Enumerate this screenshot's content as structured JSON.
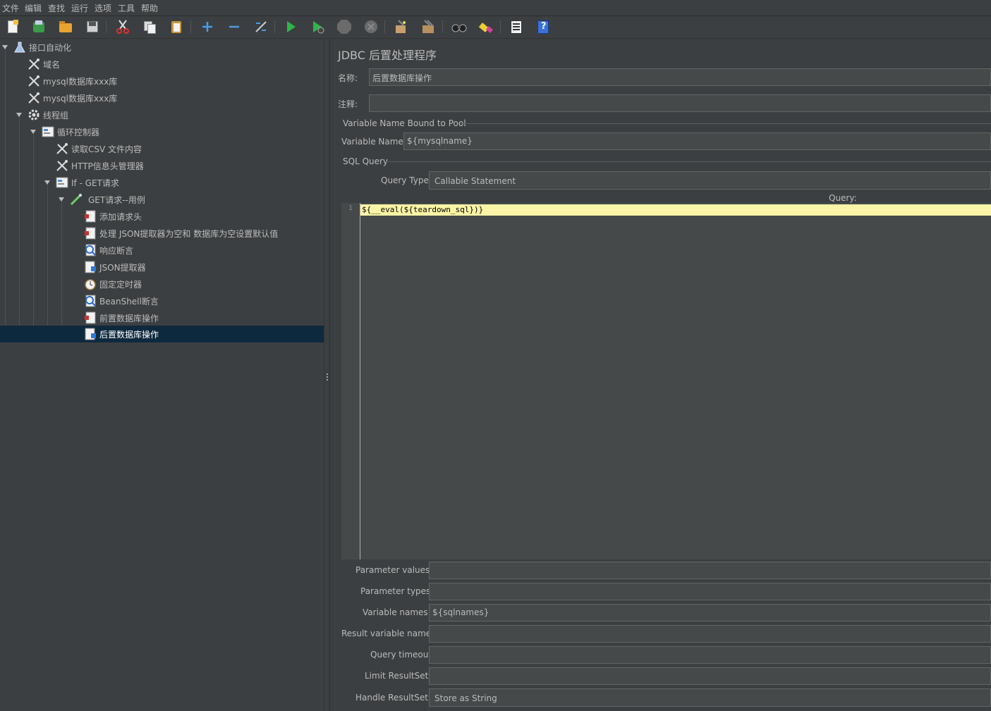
{
  "menu": [
    "文件",
    "编辑",
    "查找",
    "运行",
    "选项",
    "工具",
    "帮助"
  ],
  "toolbar_icons": [
    "new-icon",
    "templates-icon",
    "open-icon",
    "save-icon",
    "cut-icon",
    "copy-icon",
    "paste-icon",
    "expand-icon",
    "collapse-icon",
    "toggle-icon",
    "start-icon",
    "start-no-pause-icon",
    "stop-icon",
    "shutdown-icon",
    "clear-icon",
    "clear-all-icon",
    "search-icon",
    "reset-search-icon",
    "function-helper-icon",
    "help-icon"
  ],
  "tree": [
    {
      "label": "接口自动化",
      "icon": "test-plan-icon",
      "expanded": true
    },
    {
      "label": "域名",
      "icon": "config-element-icon"
    },
    {
      "label": "mysql数据库xxx库",
      "icon": "config-element-icon"
    },
    {
      "label": "mysql数据库xxx库",
      "icon": "config-element-icon"
    },
    {
      "label": "线程组",
      "icon": "thread-group-icon",
      "expanded": true
    },
    {
      "label": "循环控制器",
      "icon": "controller-icon",
      "expanded": true
    },
    {
      "label": "读取CSV 文件内容",
      "icon": "config-element-icon"
    },
    {
      "label": "HTTP信息头管理器",
      "icon": "config-element-icon"
    },
    {
      "label": "If - GET请求",
      "icon": "controller-icon",
      "expanded": true
    },
    {
      "label": "GET请求--用例",
      "icon": "sampler-icon",
      "expanded": true
    },
    {
      "label": "添加请求头",
      "icon": "preprocessor-icon"
    },
    {
      "label": "处理 JSON提取器为空和 数据库为空设置默认值",
      "icon": "preprocessor-icon"
    },
    {
      "label": "响应断言",
      "icon": "assertion-icon"
    },
    {
      "label": "JSON提取器",
      "icon": "postprocessor-icon"
    },
    {
      "label": "固定定时器",
      "icon": "timer-icon"
    },
    {
      "label": "BeanShell断言",
      "icon": "assertion-icon"
    },
    {
      "label": "前置数据库操作",
      "icon": "preprocessor-icon"
    },
    {
      "label": "后置数据库操作",
      "icon": "postprocessor-icon",
      "selected": true
    }
  ],
  "panel": {
    "title": "JDBC 后置处理程序",
    "name_label": "名称:",
    "name_value": "后置数据库操作",
    "comment_label": "注释:",
    "comment_value": "",
    "pool_group": "Variable Name Bound to Pool",
    "var_name_label": "Variable Name:",
    "var_name_value": "${mysqlname}",
    "sql_group": "SQL Query",
    "query_type_label": "Query Type:",
    "query_type_value": "Callable Statement",
    "query_label": "Query:",
    "query_line_no": "1",
    "query_code": "${__eval(${teardown_sql})}",
    "params": [
      {
        "label": "Parameter values:",
        "value": ""
      },
      {
        "label": "Parameter types:",
        "value": ""
      },
      {
        "label": "Variable names:",
        "value": "${sqlnames}"
      },
      {
        "label": "Result variable name:",
        "value": ""
      },
      {
        "label": "Query timeout:",
        "value": ""
      },
      {
        "label": "Limit ResultSet:",
        "value": ""
      },
      {
        "label": "Handle ResultSet:",
        "value": "Store as String"
      }
    ]
  }
}
